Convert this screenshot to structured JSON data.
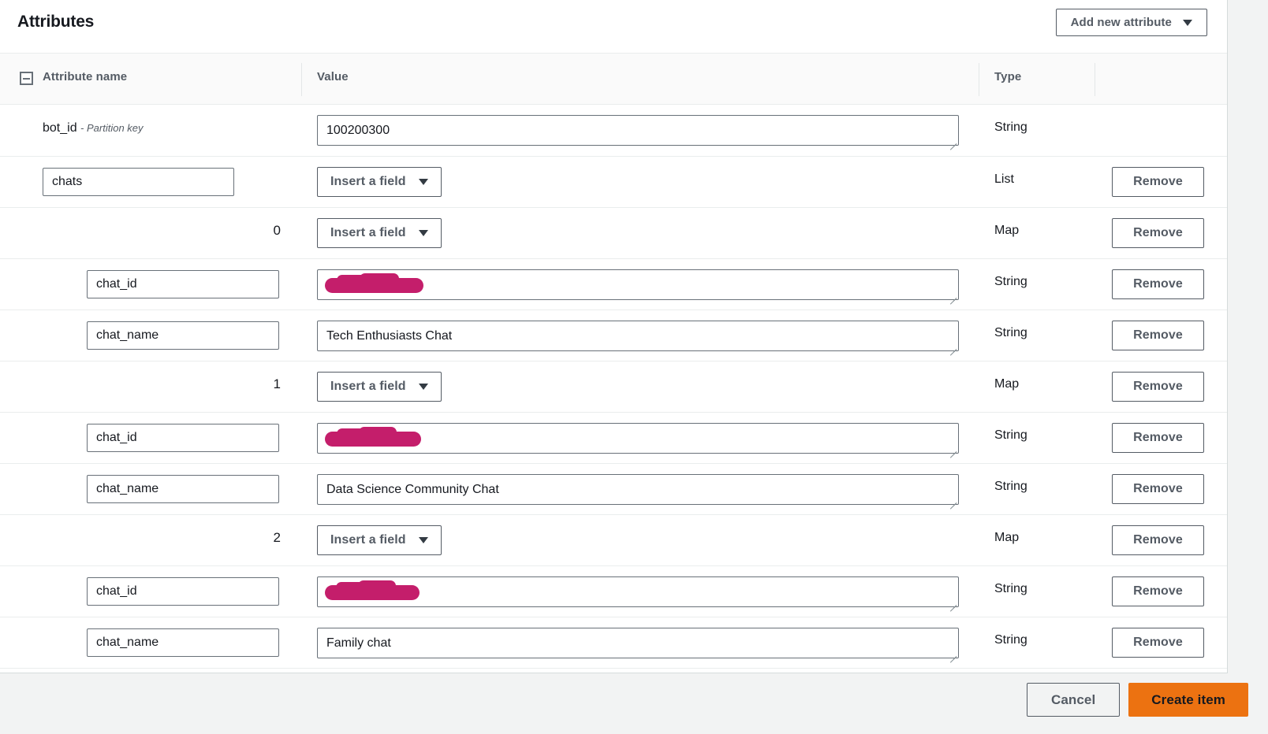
{
  "panel": {
    "title": "Attributes",
    "add_attribute_label": "Add new attribute",
    "caret_icon": "chevron-down-icon"
  },
  "table": {
    "headers": {
      "name": "Attribute name",
      "value": "Value",
      "type": "Type"
    },
    "collapse_icon": "collapse-minus-icon"
  },
  "rows": [
    {
      "name": "bot_id",
      "name_suffix": "- Partition key",
      "value": "100200300",
      "type": "String",
      "remove_label": null
    },
    {
      "name": "chats",
      "value_button": "Insert a field",
      "type": "List",
      "remove_label": "Remove"
    },
    {
      "index": "0",
      "value_button": "Insert a field",
      "type": "Map",
      "remove_label": "Remove"
    },
    {
      "name": "chat_id",
      "value": "",
      "redacted": true,
      "type": "String",
      "remove_label": "Remove"
    },
    {
      "name": "chat_name",
      "value": "Tech Enthusiasts Chat",
      "type": "String",
      "remove_label": "Remove"
    },
    {
      "index": "1",
      "value_button": "Insert a field",
      "type": "Map",
      "remove_label": "Remove"
    },
    {
      "name": "chat_id",
      "value": "",
      "redacted": true,
      "type": "String",
      "remove_label": "Remove"
    },
    {
      "name": "chat_name",
      "value": "Data Science Community Chat",
      "type": "String",
      "remove_label": "Remove"
    },
    {
      "index": "2",
      "value_button": "Insert a field",
      "type": "Map",
      "remove_label": "Remove"
    },
    {
      "name": "chat_id",
      "value": "",
      "redacted": true,
      "type": "String",
      "remove_label": "Remove"
    },
    {
      "name": "chat_name",
      "value": "Family chat",
      "type": "String",
      "remove_label": "Remove"
    }
  ],
  "footer": {
    "cancel_label": "Cancel",
    "create_label": "Create item"
  },
  "colors": {
    "accent": "#ec7211",
    "redaction": "#c41e6b",
    "border": "#687078",
    "row_divider": "#eaeded"
  }
}
